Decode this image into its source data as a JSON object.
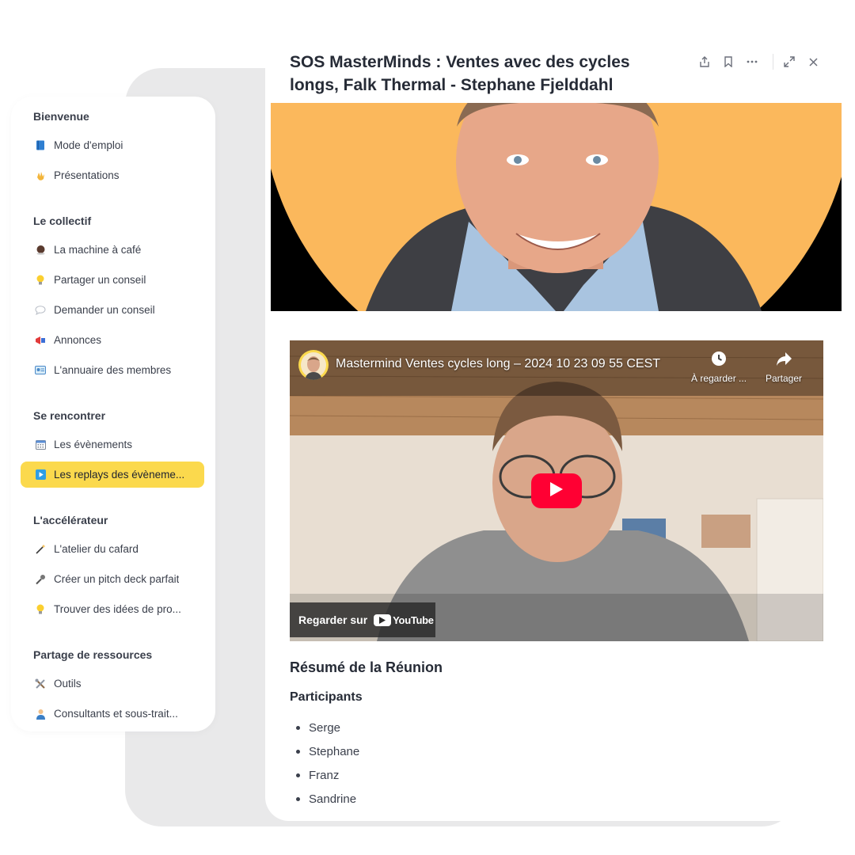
{
  "sidebar": {
    "sections": [
      {
        "title": "Bienvenue",
        "items": [
          {
            "label": "Mode d'emploi",
            "icon": "book-icon"
          },
          {
            "label": "Présentations",
            "icon": "waving-hand-icon"
          }
        ]
      },
      {
        "title": "Le collectif",
        "items": [
          {
            "label": "La machine à café",
            "icon": "coffee-icon"
          },
          {
            "label": "Partager un conseil",
            "icon": "lightbulb-icon"
          },
          {
            "label": "Demander un conseil",
            "icon": "speech-bubble-icon"
          },
          {
            "label": "Annonces",
            "icon": "megaphone-icon"
          },
          {
            "label": "L'annuaire des membres",
            "icon": "id-card-icon"
          }
        ]
      },
      {
        "title": "Se rencontrer",
        "items": [
          {
            "label": "Les évènements",
            "icon": "calendar-icon"
          },
          {
            "label": "Les replays des évèneme...",
            "icon": "play-button-icon",
            "active": true
          }
        ]
      },
      {
        "title": "L'accélérateur",
        "items": [
          {
            "label": "L'atelier du cafard",
            "icon": "magic-wand-icon"
          },
          {
            "label": "Créer un pitch deck parfait",
            "icon": "microphone-icon"
          },
          {
            "label": "Trouver des idées de pro...",
            "icon": "lightbulb-icon"
          }
        ]
      },
      {
        "title": "Partage de ressources",
        "items": [
          {
            "label": "Outils",
            "icon": "tools-icon"
          },
          {
            "label": "Consultants et sous-trait...",
            "icon": "person-icon"
          }
        ]
      }
    ]
  },
  "main": {
    "title": "SOS MasterMinds : Ventes avec des cycles longs, Falk Thermal - Stephane Fjelddahl",
    "toolbar": [
      "share-icon",
      "bookmark-icon",
      "more-icon",
      "expand-icon",
      "close-icon"
    ],
    "video": {
      "title": "Mastermind Ventes cycles long – 2024 10 23 09 55 CEST",
      "watch_later": "À regarder ...",
      "share": "Partager",
      "watch_on": "Regarder sur",
      "youtube": "YouTube"
    },
    "summary_heading": "Résumé de la Réunion",
    "participants_heading": "Participants",
    "participants": [
      "Serge",
      "Stephane",
      "Franz",
      "Sandrine"
    ]
  },
  "colors": {
    "accent": "#fbd94d",
    "hero_bg": "#fbb85c",
    "youtube_red": "#ff0033"
  }
}
